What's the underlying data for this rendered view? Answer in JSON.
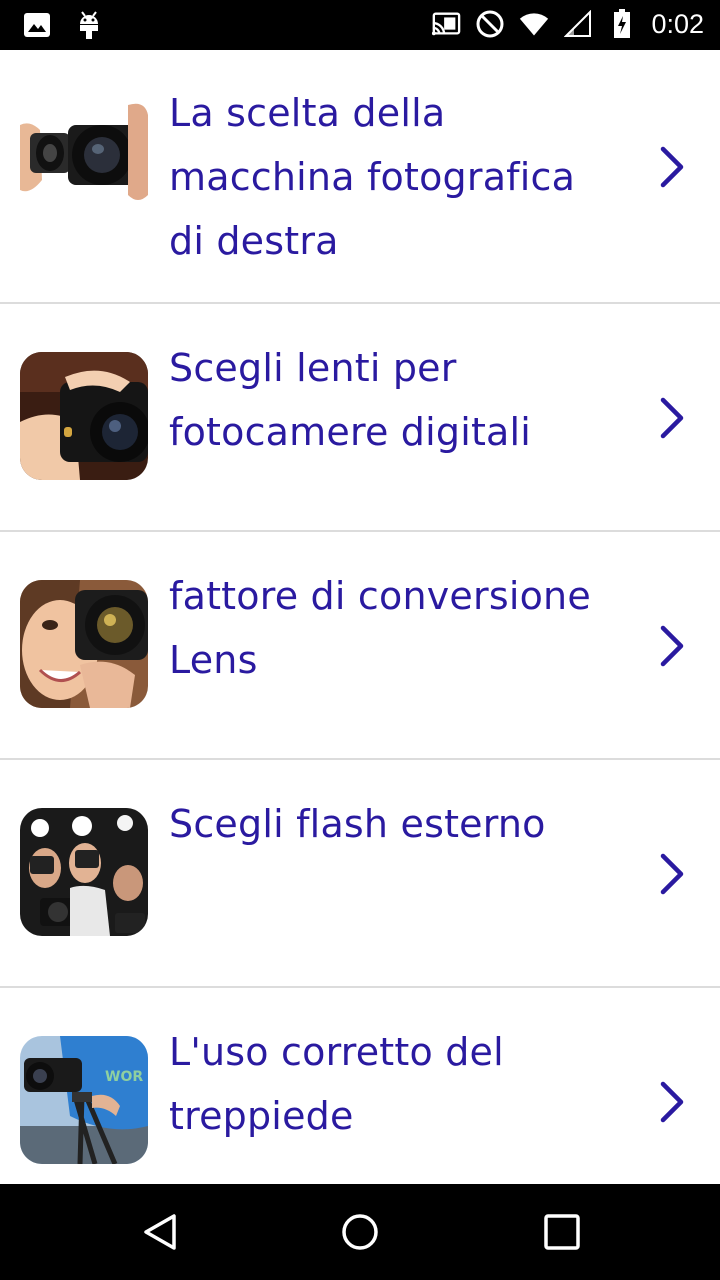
{
  "status_bar": {
    "time": "0:02",
    "icons": [
      "image-icon",
      "android-icon",
      "cast-icon",
      "do-not-disturb-icon",
      "wifi-icon",
      "signal-icon",
      "battery-charging-icon"
    ]
  },
  "list": {
    "items": [
      {
        "title": "La scelta della macchina fotografica di destra",
        "thumbnail": "camera-lens-photo",
        "chevron": "chevron-right-icon"
      },
      {
        "title": "Scegli lenti per fotocamere digitali",
        "thumbnail": "hands-camera-photo",
        "chevron": "chevron-right-icon"
      },
      {
        "title": "fattore di conversione Lens",
        "thumbnail": "woman-camera-photo",
        "chevron": "chevron-right-icon"
      },
      {
        "title": "Scegli flash esterno",
        "thumbnail": "photographers-flash-photo",
        "chevron": "chevron-right-icon"
      },
      {
        "title": "L'uso corretto del treppiede",
        "thumbnail": "tripod-camera-photo",
        "chevron": "chevron-right-icon"
      }
    ]
  },
  "nav_bar": {
    "buttons": [
      "back-icon",
      "home-icon",
      "recents-icon"
    ]
  },
  "colors": {
    "title_text": "#2a1aa0",
    "chevron": "#2a1aa0",
    "divider": "#dcdcdc",
    "bars": "#000000"
  }
}
